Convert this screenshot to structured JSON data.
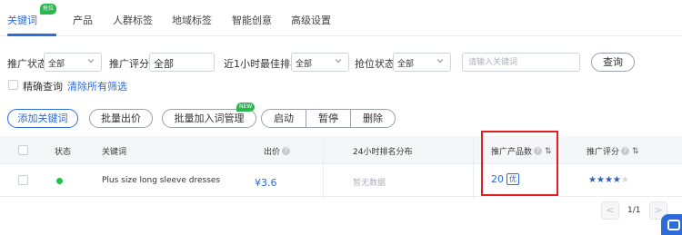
{
  "tabs": [
    {
      "label": "关键词",
      "active": true
    },
    {
      "label": "产品"
    },
    {
      "label": "人群标签"
    },
    {
      "label": "地域标签"
    },
    {
      "label": "智能创意"
    },
    {
      "label": "高级设置"
    }
  ],
  "tab_badge": "抢位",
  "filters": {
    "status_label": "推广状态:",
    "status_value": "全部",
    "score_label": "推广评分:",
    "score_value": "全部",
    "rank_label": "近1小时最佳排名:",
    "rank_value": "全部",
    "grab_label": "抢位状态:",
    "grab_value": "全部",
    "keyword_placeholder": "请输入关键词",
    "query_button": "查询"
  },
  "options": {
    "exact_label": "精确查询",
    "clear_link": "清除所有筛选"
  },
  "actions": {
    "add_keyword": "添加关键词",
    "batch_bid": "批量出价",
    "batch_add_group": "批量加入词管理",
    "new_badge": "NEW",
    "start": "启动",
    "pause": "暂停",
    "delete": "删除"
  },
  "table": {
    "headers": {
      "status": "状态",
      "keyword": "关键词",
      "bid": "出价",
      "rank_dist": "24小时排名分布",
      "product_count": "推广产品数",
      "score": "推广评分"
    },
    "rows": [
      {
        "status": "active",
        "keyword": "Plus size long sleeve dresses",
        "bid": "¥3.6",
        "rank_dist": "暂无数据",
        "product_count": "20",
        "product_badge": "优",
        "score_stars": 4,
        "score_max": 5
      }
    ]
  },
  "pagination": {
    "prev": "<",
    "next": ">",
    "page_text": "1/1"
  },
  "colors": {
    "accent": "#2b6cd9",
    "badge_green": "#2ab84e",
    "status_active": "#23c343",
    "highlight_red": "#e02020"
  }
}
